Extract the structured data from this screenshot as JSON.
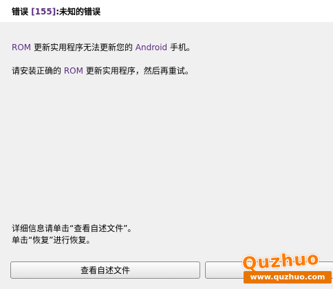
{
  "dialog": {
    "title_prefix": "错误",
    "title_code": "[155]",
    "title_suffix": ":未知的错误",
    "message1": {
      "part1": "ROM",
      "part2": " 更新实用程序无法更新您的 ",
      "part3": "Android",
      "part4": " 手机。"
    },
    "message2": {
      "part1": "请安装正确的 ",
      "part2": "ROM",
      "part3": " 更新实用程序，然后再重试。"
    },
    "footer_line1": "详细信息请单击“查看自述文件”。",
    "footer_line2": "单击“恢复”进行恢复。",
    "buttons": {
      "view_readme": "查看自述文件",
      "restore": ""
    }
  },
  "watermark": {
    "logo": "Quzhuo",
    "url": "www.quzhuo.com"
  },
  "colors": {
    "accent": "#5a2d82",
    "background": "#f0f0f0",
    "watermark": "#ff7a00"
  }
}
